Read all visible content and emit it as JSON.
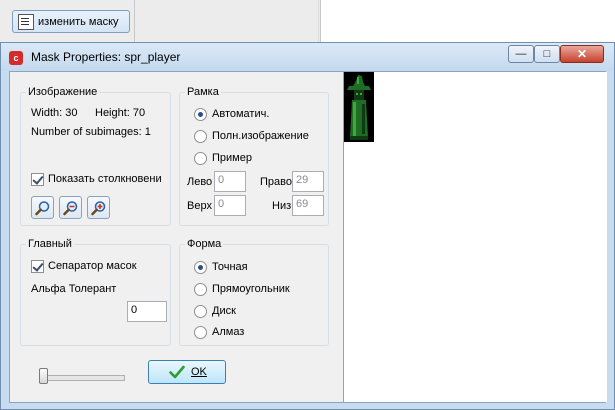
{
  "background": {
    "mask_button_label": "изменить маску"
  },
  "window": {
    "title": "Mask Properties: spr_player",
    "app_icon_letter": "c"
  },
  "image_group": {
    "title": "Изображение",
    "width_text": "Width: 30",
    "height_text": "Height: 70",
    "subimages_text": "Number of subimages: 1",
    "show_collision_label": "Показать столкновени",
    "show_collision_checked": true
  },
  "bbox_group": {
    "title": "Рамка",
    "options": [
      {
        "label": "Автоматич.",
        "selected": true
      },
      {
        "label": "Полн.изображение",
        "selected": false
      },
      {
        "label": "Пример",
        "selected": false
      }
    ],
    "left_label": "Лево",
    "left_value": "0",
    "right_label": "Право",
    "right_value": "29",
    "top_label": "Верх",
    "top_value": "0",
    "bottom_label": "Низ",
    "bottom_value": "69"
  },
  "general_group": {
    "title": "Главный",
    "separate_masks_label": "Сепаратор масок",
    "separate_masks_checked": true,
    "alpha_label": "Альфа Толерант",
    "alpha_value": "0"
  },
  "shape_group": {
    "title": "Форма",
    "options": [
      {
        "label": "Точная",
        "selected": true
      },
      {
        "label": "Прямоугольник",
        "selected": false
      },
      {
        "label": "Диск",
        "selected": false
      },
      {
        "label": "Алмаз",
        "selected": false
      }
    ]
  },
  "ok_button": {
    "label": "OK"
  },
  "colors": {
    "sprite_dark_green": "#0f3a14",
    "sprite_green": "#1f6d25",
    "sprite_light_green": "#3ea838"
  }
}
